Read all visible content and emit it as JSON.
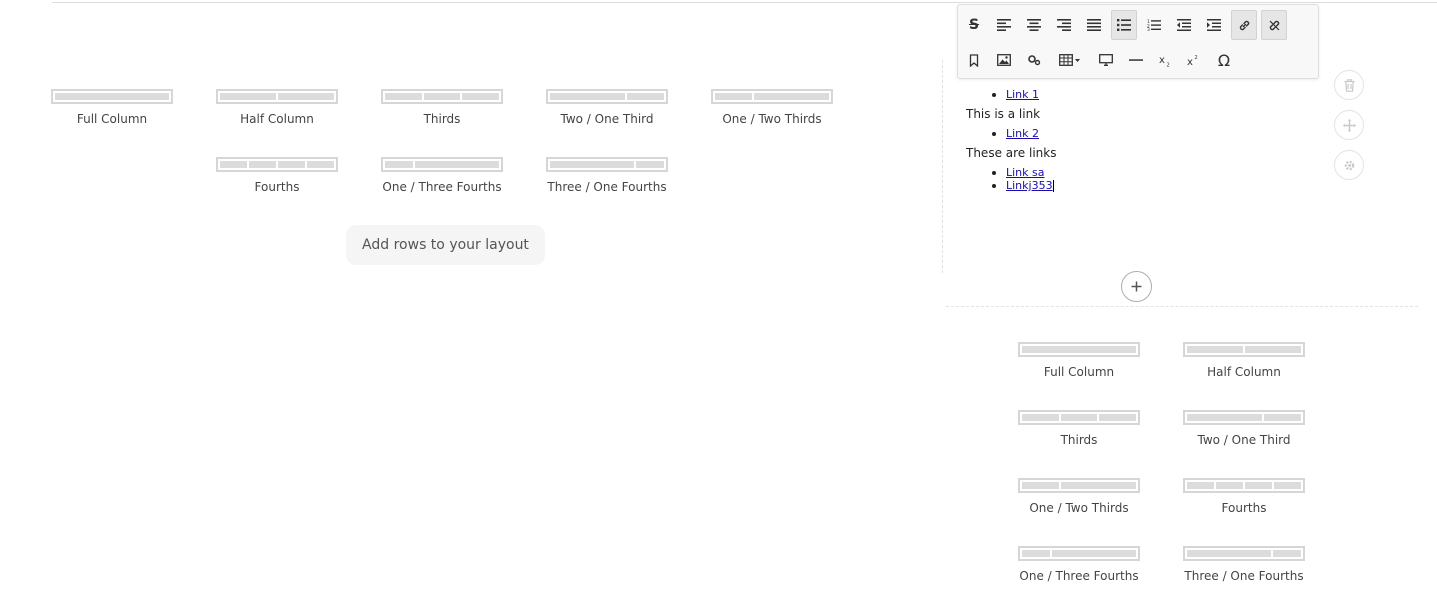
{
  "layouts_main": [
    {
      "label": "Full Column",
      "segments": [
        1
      ]
    },
    {
      "label": "Half Column",
      "segments": [
        1,
        1
      ]
    },
    {
      "label": "Thirds",
      "segments": [
        1,
        1,
        1
      ]
    },
    {
      "label": "Two / One Third",
      "segments": [
        2,
        1
      ]
    },
    {
      "label": "One / Two Thirds",
      "segments": [
        1,
        2
      ]
    },
    {
      "label": "Fourths",
      "segments": [
        1,
        1,
        1,
        1
      ]
    },
    {
      "label": "One / Three Fourths",
      "segments": [
        1,
        3
      ]
    },
    {
      "label": "Three / One Fourths",
      "segments": [
        3,
        1
      ]
    }
  ],
  "add_rows_label": "Add rows to your layout",
  "editor": {
    "link1": "Link 1",
    "text1": "This is a link",
    "link2": "Link 2",
    "text2": "These are links",
    "link3": "Link sa",
    "link4": "Linkj353"
  },
  "toolbar": {
    "row1": [
      "strikethrough-icon",
      "align-left-icon",
      "align-center-icon",
      "align-right-icon",
      "align-justify-icon",
      "bulleted-list-icon",
      "numbered-list-icon",
      "outdent-icon",
      "indent-icon",
      "link-icon",
      "unlink-icon"
    ],
    "row2": [
      "anchor-icon",
      "image-icon",
      "embed-icon",
      "table-icon",
      "preview-icon",
      "horizontal-rule-icon",
      "subscript-icon",
      "superscript-icon",
      "special-character-icon"
    ],
    "omega": "Ω",
    "strike": "S"
  },
  "layouts_bottom": [
    {
      "label": "Full Column",
      "segments": [
        1
      ]
    },
    {
      "label": "Half Column",
      "segments": [
        1,
        1
      ]
    },
    {
      "label": "Thirds",
      "segments": [
        1,
        1,
        1
      ]
    },
    {
      "label": "Two / One Third",
      "segments": [
        2,
        1
      ]
    },
    {
      "label": "One / Two Thirds",
      "segments": [
        1,
        2
      ]
    },
    {
      "label": "Fourths",
      "segments": [
        1,
        1,
        1,
        1
      ]
    },
    {
      "label": "One / Three Fourths",
      "segments": [
        1,
        3
      ]
    },
    {
      "label": "Three / One Fourths",
      "segments": [
        3,
        1
      ]
    }
  ]
}
